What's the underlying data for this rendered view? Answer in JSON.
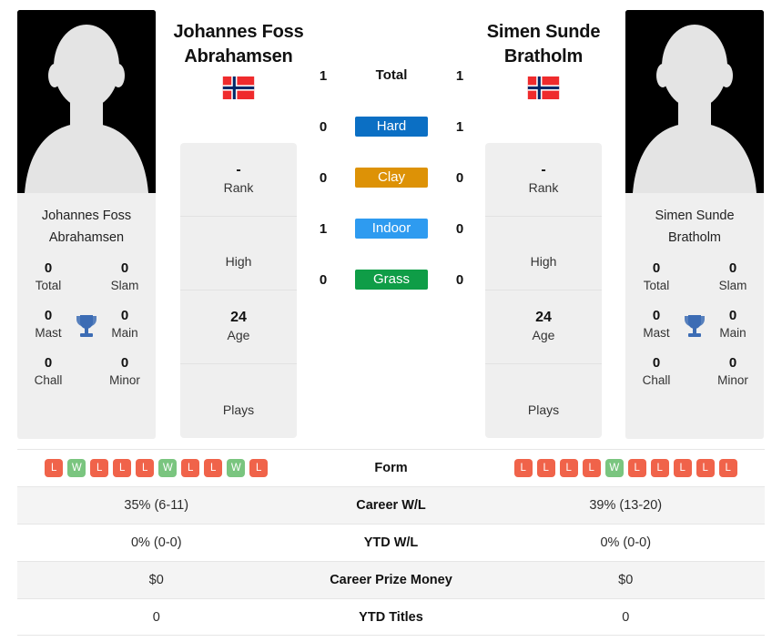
{
  "players": {
    "left": {
      "name": "Johannes Foss Abrahamsen",
      "name_line1": "Johannes Foss",
      "name_line2": "Abrahamsen",
      "country": "Norway",
      "flag": "norway-flag",
      "avatar_caption_line1": "Johannes Foss",
      "avatar_caption_line2": "Abrahamsen",
      "info": [
        {
          "value": "-",
          "label": "Rank"
        },
        {
          "value": "",
          "label": "High"
        },
        {
          "value": "24",
          "label": "Age"
        },
        {
          "value": "",
          "label": "Plays"
        }
      ],
      "titles": [
        {
          "value": "0",
          "label": "Total"
        },
        {
          "value": "0",
          "label": "Slam"
        },
        {
          "value": "0",
          "label": "Mast"
        },
        {
          "value": "0",
          "label": "Main"
        },
        {
          "value": "0",
          "label": "Chall"
        },
        {
          "value": "0",
          "label": "Minor"
        }
      ],
      "form": [
        "L",
        "W",
        "L",
        "L",
        "L",
        "W",
        "L",
        "L",
        "W",
        "L"
      ],
      "career_wl": "35% (6-11)",
      "ytd_wl": "0% (0-0)",
      "career_prize_money": "$0",
      "ytd_titles": "0"
    },
    "right": {
      "name": "Simen Sunde Bratholm",
      "name_line1": "Simen Sunde",
      "name_line2": "Bratholm",
      "country": "Norway",
      "flag": "norway-flag",
      "avatar_caption_line1": "Simen Sunde",
      "avatar_caption_line2": "Bratholm",
      "info": [
        {
          "value": "-",
          "label": "Rank"
        },
        {
          "value": "",
          "label": "High"
        },
        {
          "value": "24",
          "label": "Age"
        },
        {
          "value": "",
          "label": "Plays"
        }
      ],
      "titles": [
        {
          "value": "0",
          "label": "Total"
        },
        {
          "value": "0",
          "label": "Slam"
        },
        {
          "value": "0",
          "label": "Mast"
        },
        {
          "value": "0",
          "label": "Main"
        },
        {
          "value": "0",
          "label": "Chall"
        },
        {
          "value": "0",
          "label": "Minor"
        }
      ],
      "form": [
        "L",
        "L",
        "L",
        "L",
        "W",
        "L",
        "L",
        "L",
        "L",
        "L"
      ],
      "career_wl": "39% (13-20)",
      "ytd_wl": "0% (0-0)",
      "career_prize_money": "$0",
      "ytd_titles": "0"
    }
  },
  "head_to_head": [
    {
      "label": "Total",
      "left": "1",
      "right": "1",
      "color": ""
    },
    {
      "label": "Hard",
      "left": "0",
      "right": "1",
      "color": "#0b6fc4"
    },
    {
      "label": "Clay",
      "left": "0",
      "right": "0",
      "color": "#dd9206"
    },
    {
      "label": "Indoor",
      "left": "1",
      "right": "0",
      "color": "#2e9bf0"
    },
    {
      "label": "Grass",
      "left": "0",
      "right": "0",
      "color": "#0f9d47"
    }
  ],
  "stats_rows": [
    {
      "label": "Form",
      "left": "",
      "right": "",
      "type": "form"
    },
    {
      "label": "Career W/L",
      "left": "35% (6-11)",
      "right": "39% (13-20)",
      "type": "text"
    },
    {
      "label": "YTD W/L",
      "left": "0% (0-0)",
      "right": "0% (0-0)",
      "type": "text"
    },
    {
      "label": "Career Prize Money",
      "left": "$0",
      "right": "$0",
      "type": "text"
    },
    {
      "label": "YTD Titles",
      "left": "0",
      "right": "0",
      "type": "text"
    }
  ],
  "icons": {
    "trophy": "trophy-icon",
    "avatar": "player-silhouette-icon"
  },
  "colors": {
    "hard": "#0b6fc4",
    "clay": "#dd9206",
    "indoor": "#2e9bf0",
    "grass": "#0f9d47",
    "win": "#7ac57f",
    "loss": "#f0634a",
    "trophy": "#3c6cb4",
    "panel_bg": "#efefef",
    "row_shade": "#f4f4f4"
  }
}
